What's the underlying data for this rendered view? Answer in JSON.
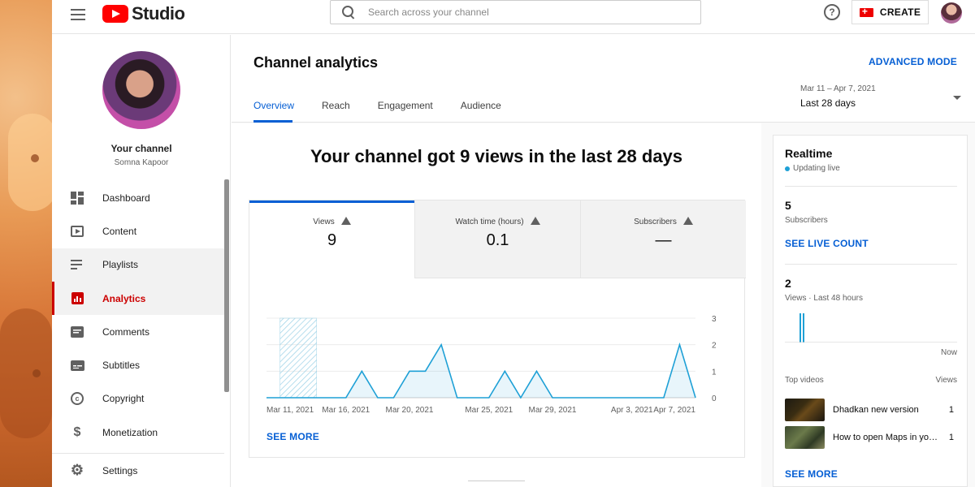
{
  "app": {
    "name": "Studio"
  },
  "search": {
    "placeholder": "Search across your channel"
  },
  "header": {
    "create_label": "CREATE"
  },
  "channel": {
    "title": "Your channel",
    "name": "Somna Kapoor"
  },
  "sidebar": {
    "items": [
      {
        "label": "Dashboard",
        "icon": "dashboard-icon"
      },
      {
        "label": "Content",
        "icon": "content-icon"
      },
      {
        "label": "Playlists",
        "icon": "playlist-icon"
      },
      {
        "label": "Analytics",
        "icon": "analytics-icon",
        "active": true
      },
      {
        "label": "Comments",
        "icon": "comments-icon"
      },
      {
        "label": "Subtitles",
        "icon": "subtitles-icon"
      },
      {
        "label": "Copyright",
        "icon": "copyright-icon"
      },
      {
        "label": "Monetization",
        "icon": "dollar-icon"
      }
    ],
    "settings_label": "Settings"
  },
  "page": {
    "title": "Channel analytics",
    "advanced_mode": "ADVANCED MODE",
    "tabs": [
      "Overview",
      "Reach",
      "Engagement",
      "Audience"
    ],
    "active_tab": "Overview",
    "date_range": {
      "sub": "Mar 11 – Apr 7, 2021",
      "main": "Last 28 days"
    },
    "headline": "Your channel got 9 views in the last 28 days",
    "metrics": [
      {
        "label": "Views",
        "value": "9"
      },
      {
        "label": "Watch time (hours)",
        "value": "0.1"
      },
      {
        "label": "Subscribers",
        "value": "—"
      }
    ],
    "see_more": "SEE MORE"
  },
  "colors": {
    "accent": "#065fd4",
    "brand": "#ff0000",
    "active_nav": "#cc0000",
    "chart_line": "#1ea0d6"
  },
  "chart_data": {
    "type": "line",
    "x": [
      "Mar 11",
      "Mar 12",
      "Mar 13",
      "Mar 14",
      "Mar 15",
      "Mar 16",
      "Mar 17",
      "Mar 18",
      "Mar 19",
      "Mar 20",
      "Mar 21",
      "Mar 22",
      "Mar 23",
      "Mar 24",
      "Mar 25",
      "Mar 26",
      "Mar 27",
      "Mar 28",
      "Mar 29",
      "Mar 30",
      "Mar 31",
      "Apr 1",
      "Apr 2",
      "Apr 3",
      "Apr 4",
      "Apr 5",
      "Apr 6",
      "Apr 7"
    ],
    "values": [
      0,
      0,
      0,
      0,
      0,
      0,
      1,
      0,
      0,
      1,
      1,
      2,
      0,
      0,
      0,
      1,
      0,
      1,
      0,
      0,
      0,
      0,
      0,
      0,
      0,
      0,
      2,
      0
    ],
    "x_tick_labels": [
      "Mar 11, 2021",
      "Mar 16, 2021",
      "Mar 20, 2021",
      "Mar 25, 2021",
      "Mar 29, 2021",
      "Apr 3, 2021",
      "Apr 7, 2021"
    ],
    "y_ticks": [
      0,
      1,
      2,
      3
    ],
    "ylim": [
      0,
      3
    ],
    "highlight_range": [
      "Mar 12",
      "Mar 14"
    ],
    "grid": true
  },
  "realtime": {
    "title": "Realtime",
    "status": "Updating live",
    "subscribers": "5",
    "subscribers_label": "Subscribers",
    "see_live_count": "SEE LIVE COUNT",
    "views": "2",
    "views_label": "Views · Last 48 hours",
    "now_label": "Now",
    "top_videos_label": "Top videos",
    "views_col_label": "Views",
    "videos": [
      {
        "title": "Dhadkan new version",
        "views": "1"
      },
      {
        "title": "How to open Maps in your...",
        "views": "1"
      }
    ],
    "see_more": "SEE MORE"
  }
}
